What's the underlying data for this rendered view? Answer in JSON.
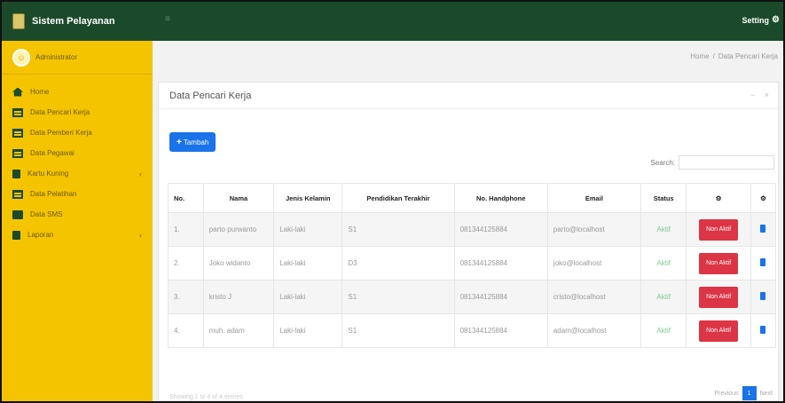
{
  "app": {
    "title": "Sistem Pelayanan"
  },
  "topbar": {
    "setting_label": "Setting"
  },
  "user": {
    "name": "Administrator"
  },
  "sidebar": {
    "items": [
      {
        "label": "Home",
        "icon": "home-icon",
        "has_submenu": false
      },
      {
        "label": "Data Pencari Kerja",
        "icon": "table-icon",
        "has_submenu": false
      },
      {
        "label": "Data Pemberi Kerja",
        "icon": "table-icon",
        "has_submenu": false
      },
      {
        "label": "Data Pegawai",
        "icon": "table-icon",
        "has_submenu": false
      },
      {
        "label": "Kartu Kuning",
        "icon": "book-icon",
        "has_submenu": true
      },
      {
        "label": "Data Pelatihan",
        "icon": "table-icon",
        "has_submenu": false
      },
      {
        "label": "Data SMS",
        "icon": "card-icon",
        "has_submenu": false
      },
      {
        "label": "Laporan",
        "icon": "book-icon",
        "has_submenu": true
      }
    ]
  },
  "breadcrumb": {
    "home": "Home",
    "separator": "/",
    "current": "Data Pencari Kerja"
  },
  "card": {
    "title": "Data Pencari Kerja",
    "add_label": "Tambah",
    "search_label": "Search:",
    "search_value": ""
  },
  "table": {
    "headers": [
      "No.",
      "Nama",
      "Jenis Kelamin",
      "Pendidikan Terakhir",
      "No. Handphone",
      "Email",
      "Status"
    ],
    "action_header_icons": [
      "gear-icon",
      "gear-icon"
    ],
    "action_button_label": "Non Aktif",
    "rows": [
      {
        "no": "1.",
        "nama": "parto purwanto",
        "jenis_kelamin": "Laki-laki",
        "pendidikan": "S1",
        "hp": "081344125884",
        "email": "parto@localhost",
        "status": "Aktif"
      },
      {
        "no": "2.",
        "nama": "Joko widanto",
        "jenis_kelamin": "Laki-laki",
        "pendidikan": "D3",
        "hp": "081344125884",
        "email": "joko@localhost",
        "status": "Aktif"
      },
      {
        "no": "3.",
        "nama": "kristo J",
        "jenis_kelamin": "Laki-laki",
        "pendidikan": "S1",
        "hp": "081344125884",
        "email": "cristo@localhost",
        "status": "Aktif"
      },
      {
        "no": "4.",
        "nama": "muh. adam",
        "jenis_kelamin": "Laki-laki",
        "pendidikan": "S1",
        "hp": "081344125884",
        "email": "adam@localhost",
        "status": "Aktif"
      }
    ]
  },
  "footer": {
    "info": "Showing 1 to 4 of 4 entries",
    "prev": "Previous",
    "page": "1",
    "next": "Next"
  },
  "colors": {
    "sidebar": "#f5c400",
    "header": "#1b4a2b",
    "primary": "#1a73e8",
    "danger": "#dc3545",
    "success": "#28a745"
  }
}
